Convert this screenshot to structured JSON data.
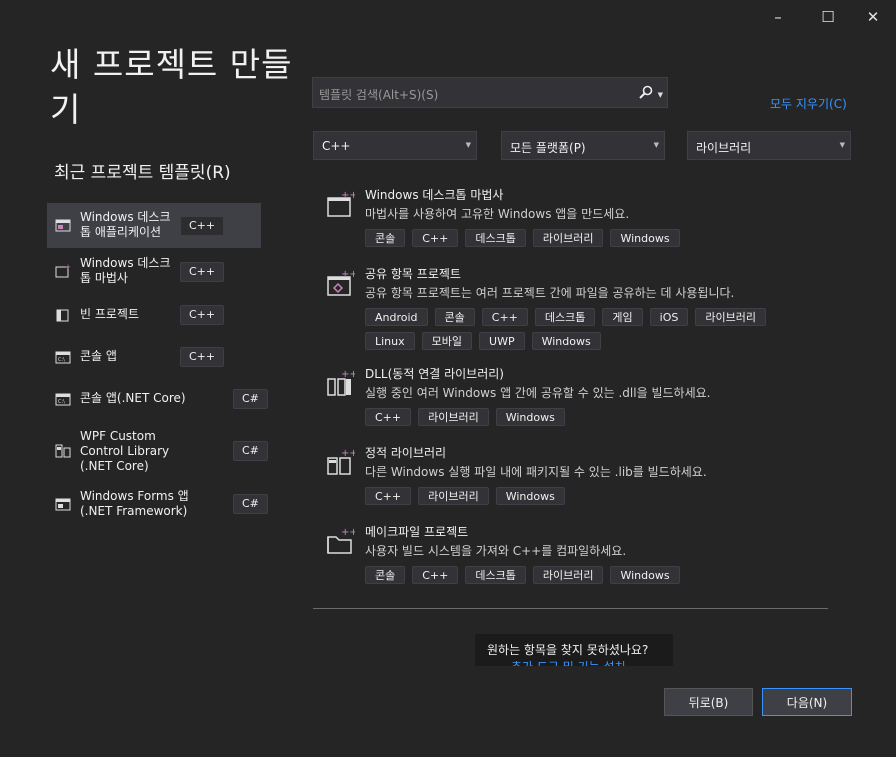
{
  "window_controls": {
    "minimize": "–",
    "maximize": "☐",
    "close": "✕"
  },
  "title": "새 프로젝트 만들기",
  "recent_header": "최근 프로젝트 템플릿(R)",
  "recent_items": [
    {
      "label": "Windows 데스크톱 애플리케이션",
      "tag": "C++",
      "selected": true
    },
    {
      "label": "Windows 데스크톱 마법사",
      "tag": "C++"
    },
    {
      "label": "빈 프로젝트",
      "tag": "C++"
    },
    {
      "label": "콘솔 앱",
      "tag": "C++"
    },
    {
      "label": "콘솔 앱(.NET Core)",
      "tag": "C#"
    },
    {
      "label": "WPF Custom Control Library (.NET Core)",
      "tag": "C#"
    },
    {
      "label": "Windows Forms 앱(.NET Framework)",
      "tag": "C#"
    }
  ],
  "search": {
    "placeholder": "템플릿 검색(Alt+S)(S)"
  },
  "clear_all": "모두 지우기(C)",
  "filters": {
    "language": "C++",
    "platform": "모든 플랫폼(P)",
    "project_type": "라이브러리"
  },
  "templates": [
    {
      "name": "Windows 데스크톱 마법사",
      "desc": "마법사를 사용하여 고유한 Windows 앱을 만드세요.",
      "tags": [
        "콘솔",
        "C++",
        "데스크톱",
        "라이브러리",
        "Windows"
      ]
    },
    {
      "name": "공유 항목 프로젝트",
      "desc": "공유 항목 프로젝트는 여러 프로젝트 간에 파일을 공유하는 데 사용됩니다.",
      "tags": [
        "Android",
        "콘솔",
        "C++",
        "데스크톱",
        "게임",
        "iOS",
        "라이브러리",
        "Linux",
        "모바일",
        "UWP",
        "Windows"
      ]
    },
    {
      "name": "DLL(동적 연결 라이브러리)",
      "desc": "실행 중인 여러 Windows 앱 간에 공유할 수 있는 .dll을 빌드하세요.",
      "tags": [
        "C++",
        "라이브러리",
        "Windows"
      ]
    },
    {
      "name": "정적 라이브러리",
      "desc": "다른 Windows 실행 파일 내에 패키지될 수 있는 .lib를 빌드하세요.",
      "tags": [
        "C++",
        "라이브러리",
        "Windows"
      ]
    },
    {
      "name": "메이크파일 프로젝트",
      "desc": "사용자 빌드 시스템을 가져와 C++를 컴파일하세요.",
      "tags": [
        "콘솔",
        "C++",
        "데스크톱",
        "라이브러리",
        "Windows"
      ]
    }
  ],
  "not_found": {
    "text": "원하는 항목을 찾지 못하셨나요?",
    "link": "추가 도구 및 기능 설치"
  },
  "buttons": {
    "back": "뒤로(B)",
    "next": "다음(N)"
  }
}
